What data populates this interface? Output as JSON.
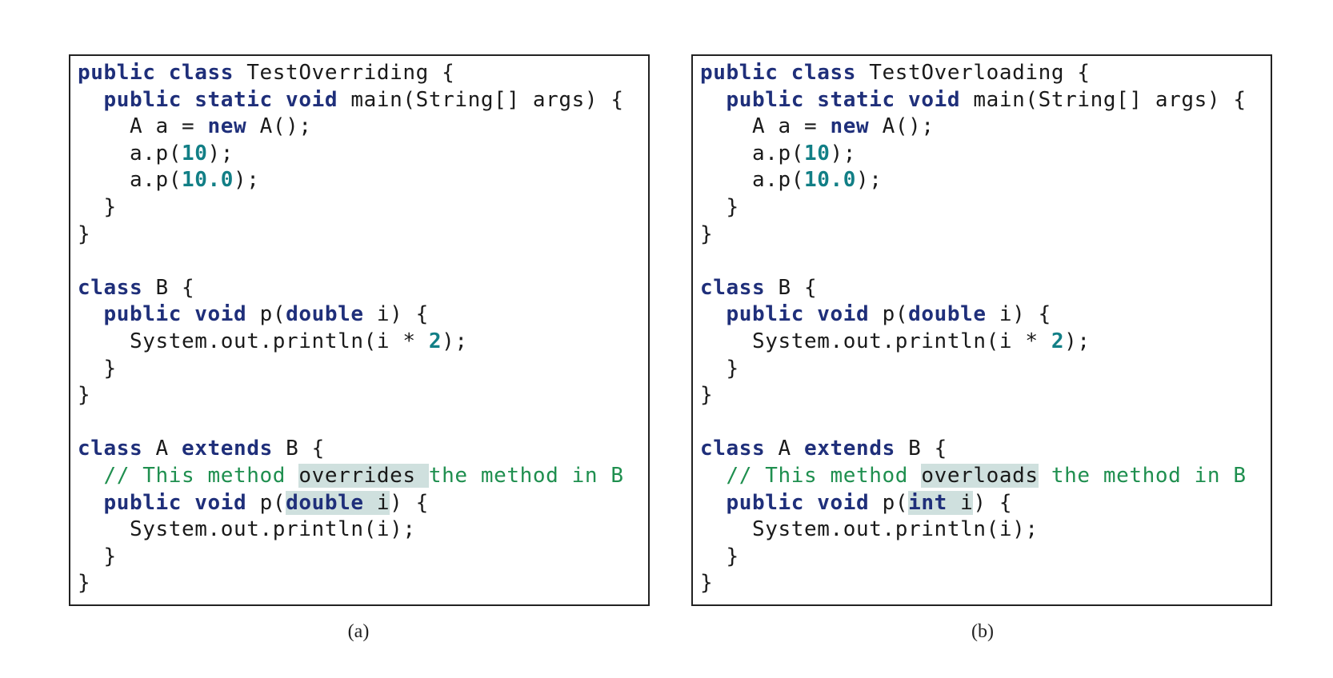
{
  "panels": [
    {
      "caption": "(a)",
      "lines": [
        [
          {
            "t": "public class",
            "s": "kw"
          },
          {
            "t": " TestOverriding {",
            "s": "tx"
          }
        ],
        [
          {
            "t": "  ",
            "s": "tx"
          },
          {
            "t": "public static void",
            "s": "kw"
          },
          {
            "t": " main(String[] args) {",
            "s": "tx"
          }
        ],
        [
          {
            "t": "    A a = ",
            "s": "tx"
          },
          {
            "t": "new",
            "s": "kw"
          },
          {
            "t": " A();",
            "s": "tx"
          }
        ],
        [
          {
            "t": "    a.p(",
            "s": "tx"
          },
          {
            "t": "10",
            "s": "num"
          },
          {
            "t": ");",
            "s": "tx"
          }
        ],
        [
          {
            "t": "    a.p(",
            "s": "tx"
          },
          {
            "t": "10.0",
            "s": "num"
          },
          {
            "t": ");",
            "s": "tx"
          }
        ],
        [
          {
            "t": "  }",
            "s": "tx"
          }
        ],
        [
          {
            "t": "}",
            "s": "tx"
          }
        ],
        [],
        [
          {
            "t": "class",
            "s": "kw"
          },
          {
            "t": " B {",
            "s": "tx"
          }
        ],
        [
          {
            "t": "  ",
            "s": "tx"
          },
          {
            "t": "public void",
            "s": "kw"
          },
          {
            "t": " p(",
            "s": "tx"
          },
          {
            "t": "double",
            "s": "kw"
          },
          {
            "t": " i) {",
            "s": "tx"
          }
        ],
        [
          {
            "t": "    System.out.println(i * ",
            "s": "tx"
          },
          {
            "t": "2",
            "s": "num"
          },
          {
            "t": ");",
            "s": "tx"
          }
        ],
        [
          {
            "t": "  }",
            "s": "tx"
          }
        ],
        [
          {
            "t": "}",
            "s": "tx"
          }
        ],
        [],
        [
          {
            "t": "class",
            "s": "kw"
          },
          {
            "t": " A ",
            "s": "tx"
          },
          {
            "t": "extends",
            "s": "kw"
          },
          {
            "t": " B {",
            "s": "tx"
          }
        ],
        [
          {
            "t": "  // This method ",
            "s": "cm"
          },
          {
            "t": "overrides ",
            "s": "hl"
          },
          {
            "t": "the method in B",
            "s": "cm"
          }
        ],
        [
          {
            "t": "  ",
            "s": "tx"
          },
          {
            "t": "public void",
            "s": "kw"
          },
          {
            "t": " p(",
            "s": "tx"
          },
          {
            "t": "double",
            "s": "hlkw"
          },
          {
            "t": " i",
            "s": "hl"
          },
          {
            "t": ") {",
            "s": "tx"
          }
        ],
        [
          {
            "t": "    System.out.println(i);",
            "s": "tx"
          }
        ],
        [
          {
            "t": "  }",
            "s": "tx"
          }
        ],
        [
          {
            "t": "}",
            "s": "tx"
          }
        ]
      ]
    },
    {
      "caption": "(b)",
      "lines": [
        [
          {
            "t": "public class",
            "s": "kw"
          },
          {
            "t": " TestOverloading {",
            "s": "tx"
          }
        ],
        [
          {
            "t": "  ",
            "s": "tx"
          },
          {
            "t": "public static void",
            "s": "kw"
          },
          {
            "t": " main(String[] args) {",
            "s": "tx"
          }
        ],
        [
          {
            "t": "    A a = ",
            "s": "tx"
          },
          {
            "t": "new",
            "s": "kw"
          },
          {
            "t": " A();",
            "s": "tx"
          }
        ],
        [
          {
            "t": "    a.p(",
            "s": "tx"
          },
          {
            "t": "10",
            "s": "num"
          },
          {
            "t": ");",
            "s": "tx"
          }
        ],
        [
          {
            "t": "    a.p(",
            "s": "tx"
          },
          {
            "t": "10.0",
            "s": "num"
          },
          {
            "t": ");",
            "s": "tx"
          }
        ],
        [
          {
            "t": "  }",
            "s": "tx"
          }
        ],
        [
          {
            "t": "}",
            "s": "tx"
          }
        ],
        [],
        [
          {
            "t": "class",
            "s": "kw"
          },
          {
            "t": " B {",
            "s": "tx"
          }
        ],
        [
          {
            "t": "  ",
            "s": "tx"
          },
          {
            "t": "public void",
            "s": "kw"
          },
          {
            "t": " p(",
            "s": "tx"
          },
          {
            "t": "double",
            "s": "kw"
          },
          {
            "t": " i) {",
            "s": "tx"
          }
        ],
        [
          {
            "t": "    System.out.println(i * ",
            "s": "tx"
          },
          {
            "t": "2",
            "s": "num"
          },
          {
            "t": ");",
            "s": "tx"
          }
        ],
        [
          {
            "t": "  }",
            "s": "tx"
          }
        ],
        [
          {
            "t": "}",
            "s": "tx"
          }
        ],
        [],
        [
          {
            "t": "class",
            "s": "kw"
          },
          {
            "t": " A ",
            "s": "tx"
          },
          {
            "t": "extends",
            "s": "kw"
          },
          {
            "t": " B {",
            "s": "tx"
          }
        ],
        [
          {
            "t": "  // This method ",
            "s": "cm"
          },
          {
            "t": "overloads",
            "s": "hl"
          },
          {
            "t": " the method in B",
            "s": "cm"
          }
        ],
        [
          {
            "t": "  ",
            "s": "tx"
          },
          {
            "t": "public void",
            "s": "kw"
          },
          {
            "t": " p(",
            "s": "tx"
          },
          {
            "t": "int",
            "s": "hlkw"
          },
          {
            "t": " i",
            "s": "hl"
          },
          {
            "t": ") {",
            "s": "tx"
          }
        ],
        [
          {
            "t": "    System.out.println(i);",
            "s": "tx"
          }
        ],
        [
          {
            "t": "  }",
            "s": "tx"
          }
        ],
        [
          {
            "t": "}",
            "s": "tx"
          }
        ]
      ]
    }
  ],
  "colors": {
    "keyword": "#1f2f7a",
    "number": "#127f86",
    "comment": "#1f8f4f",
    "highlight": "#cfe0de",
    "text": "#1a1a1a",
    "border": "#222222"
  }
}
